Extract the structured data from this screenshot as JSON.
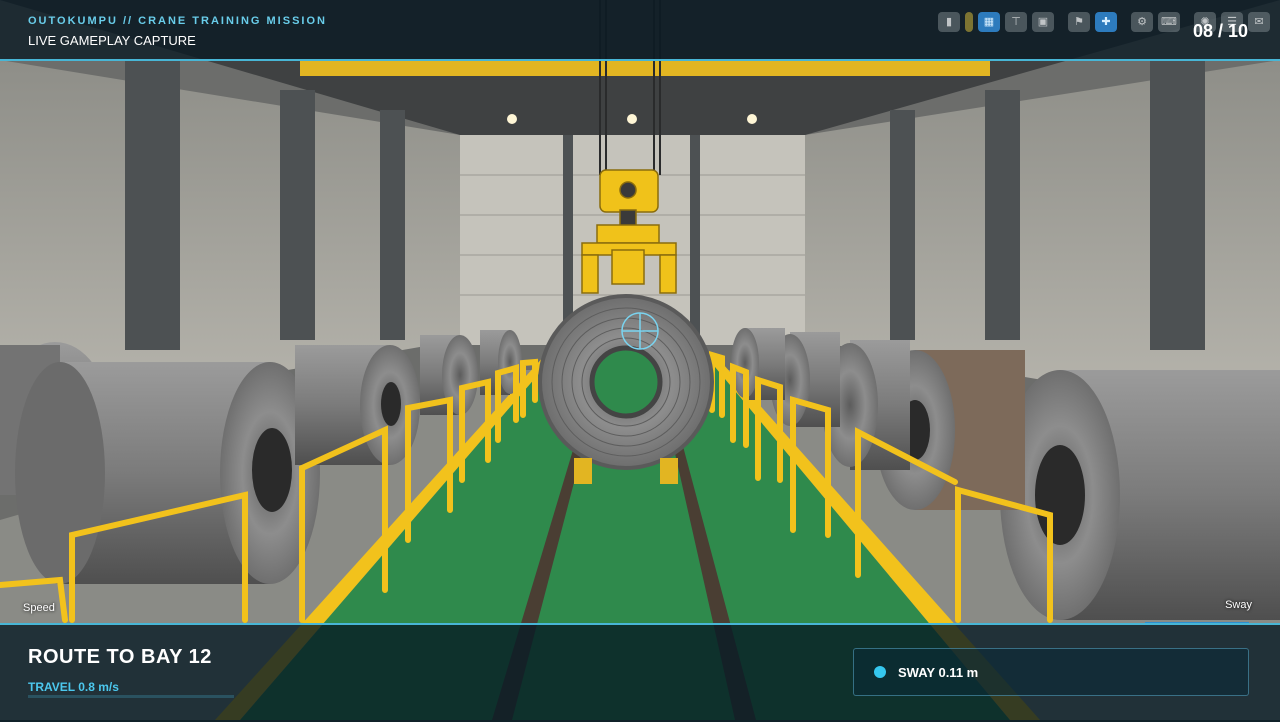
{
  "header": {
    "brand": "OUTOKUMPU // CRANE TRAINING MISSION",
    "subtitle": "LIVE GAMEPLAY CAPTURE",
    "counter": "08 / 10"
  },
  "toolbar": {
    "icons": [
      "book-icon",
      "grid-icon",
      "crane-icon",
      "screen-icon",
      "badge-icon",
      "plus-icon",
      "gear-icon",
      "keyboard-icon",
      "settings-icon",
      "map-icon",
      "chat-icon"
    ]
  },
  "hud": {
    "speed_label": "Speed",
    "sway_label": "Sway"
  },
  "mission": {
    "title": "ROUTE TO BAY 12",
    "travel": "TRAVEL 0.8 m/s"
  },
  "sway": {
    "value_text": "SWAY 0.11 m"
  },
  "colors": {
    "accent": "#48b6d6",
    "floor_green": "#2f8a4c",
    "rail_yellow": "#f2c21c",
    "crane_yellow": "#f0c21a"
  }
}
